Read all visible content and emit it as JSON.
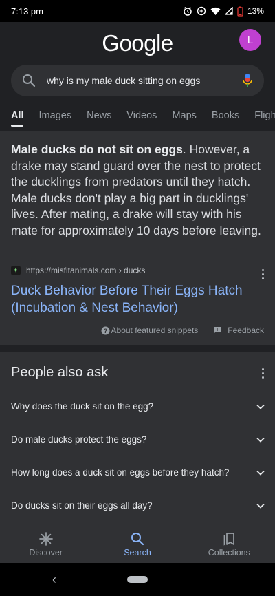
{
  "status_bar": {
    "time": "7:13 pm",
    "battery": "13%"
  },
  "header": {
    "logo": "Google",
    "avatar_letter": "L",
    "avatar_color": "#c040d0"
  },
  "search": {
    "query": "why is my male duck sitting on eggs"
  },
  "tabs": [
    "All",
    "Images",
    "News",
    "Videos",
    "Maps",
    "Books",
    "Flight"
  ],
  "featured_snippet": {
    "bold_text": "Male ducks do not sit on eggs",
    "text": ". However, a drake may stand guard over the nest to protect the ducklings from predators until they hatch. Male ducks don't play a big part in ducklings' lives. After mating, a drake will stay with his mate for approximately 10 days before leaving.",
    "source_url": "https://misfitanimals.com › ducks",
    "result_title": "Duck Behavior Before Their Eggs Hatch (Incubation & Nest Behavior)",
    "about_label": "About featured snippets",
    "feedback_label": "Feedback"
  },
  "people_also_ask": {
    "title": "People also ask",
    "questions": [
      "Why does the duck sit on the egg?",
      "Do male ducks protect the eggs?",
      "How long does a duck sit on eggs before they hatch?",
      "Do ducks sit on their eggs all day?"
    ]
  },
  "bottom_nav": {
    "discover": "Discover",
    "search": "Search",
    "collections": "Collections"
  },
  "colors": {
    "background": "#202124",
    "card": "#303134",
    "link": "#8ab4f8"
  }
}
